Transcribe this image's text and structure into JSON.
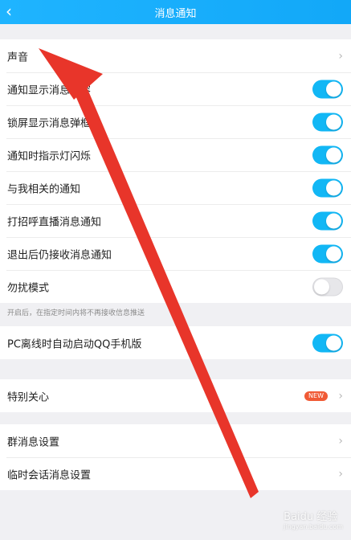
{
  "header": {
    "back_icon": "chevron-left-icon",
    "title": "消息通知"
  },
  "settings": {
    "sound": "声音",
    "show_content": "通知显示消息内容",
    "lockscreen_popup": "锁屏显示消息弹框",
    "indicator_light": "通知时指示灯闪烁",
    "related_notify": "与我相关的通知",
    "greeting_live": "打招呼直播消息通知",
    "after_exit": "退出后仍接收消息通知",
    "dnd": "勿扰模式",
    "dnd_note": "开启后，在指定时间内将不再接收信息推送",
    "pc_offline": "PC离线时自动启动QQ手机版",
    "special_care": "特别关心",
    "new_badge": "NEW",
    "group_msg": "群消息设置",
    "temp_chat": "临时会话消息设置"
  },
  "toggles": {
    "show_content": true,
    "lockscreen_popup": true,
    "indicator_light": true,
    "related_notify": true,
    "greeting_live": true,
    "after_exit": true,
    "dnd": false,
    "pc_offline": true
  },
  "colors": {
    "accent": "#12b7f5",
    "arrow": "#e8352a",
    "badge": "#f05a35"
  },
  "watermark": {
    "main": "Baidu 经验",
    "sub": "jingyan.baidu.com"
  }
}
